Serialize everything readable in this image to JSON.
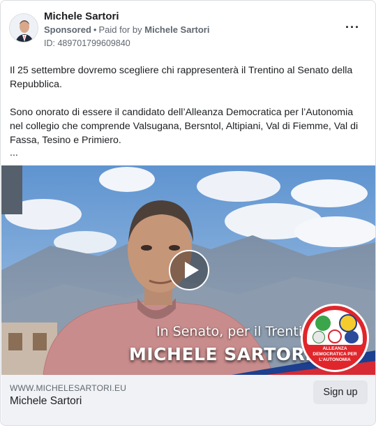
{
  "post": {
    "page_name": "Michele Sartori",
    "sponsored": "Sponsored",
    "paid_for_prefix": "Paid for by",
    "paid_for_by": "Michele Sartori",
    "ad_id": "ID: 489701799609840",
    "more_label": "···",
    "paragraph_1": "Il 25 settembre dovremo scegliere chi rappresenterà il Trentino al Senato della Repubblica.",
    "paragraph_2": "Sono onorato di essere il candidato dell’Alleanza Democratica per l’Autonomia nel collegio che comprende Valsugana, Bersntol, Altipiani, Val di Fiemme, Val di Fassa, Tesino e Primiero.",
    "ellipsis": "..."
  },
  "video": {
    "overlay_subtitle": "In Senato, per il Trentino",
    "overlay_name": "MICHELE SARTORI",
    "logo_text": "ALLEANZA DEMOCRATICA PER L’AUTONOMIA"
  },
  "footer": {
    "domain": "WWW.MICHELESARTORI.EU",
    "headline": "Michele Sartori",
    "cta_label": "Sign up"
  },
  "colors": {
    "sky": "#6f9fd4",
    "cta_bg": "#e4e6eb",
    "footer_bg": "#f0f2f5",
    "logo_red": "#e0262b"
  }
}
